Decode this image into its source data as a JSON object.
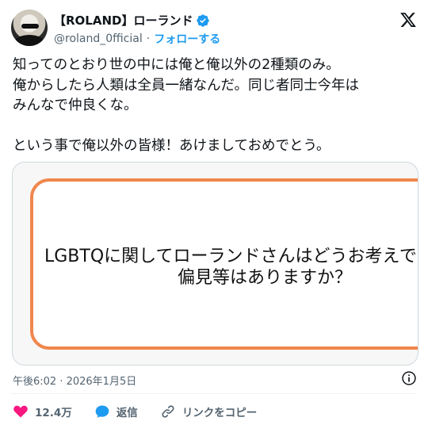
{
  "author": {
    "display_name": "【ROLAND】ローランド",
    "handle": "@roland_0fficial",
    "separator": "·",
    "follow_label": "フォローする",
    "verified_color": "#1d9bf0"
  },
  "tweet": {
    "lines": [
      "知ってのとおり世の中には俺と俺以外の2種類のみ。",
      "俺からしたら人類は全員一緒なんだ。同じ者同士今年は",
      "みんなで仲良くな。",
      "",
      "という事で俺以外の皆様！あけましておめでとう。"
    ]
  },
  "media": {
    "question_line1": "LGBTQに関してローランドさんはどうお考えで",
    "question_line2": "偏見等はありますか？",
    "border_color": "#f0874d"
  },
  "meta": {
    "timestamp": "午後6:02 · 2026年1月5日"
  },
  "actions": {
    "like_count": "12.4万",
    "reply_label": "返信",
    "copy_link_label": "リンクをコピー",
    "like_color": "#f91880",
    "reply_color": "#1d9bf0"
  },
  "icons": {
    "x_logo": "x-logo-icon",
    "verified": "verified-badge-icon",
    "info": "info-icon",
    "like": "heart-icon",
    "reply": "reply-bubble-icon",
    "copy_link": "link-icon"
  }
}
